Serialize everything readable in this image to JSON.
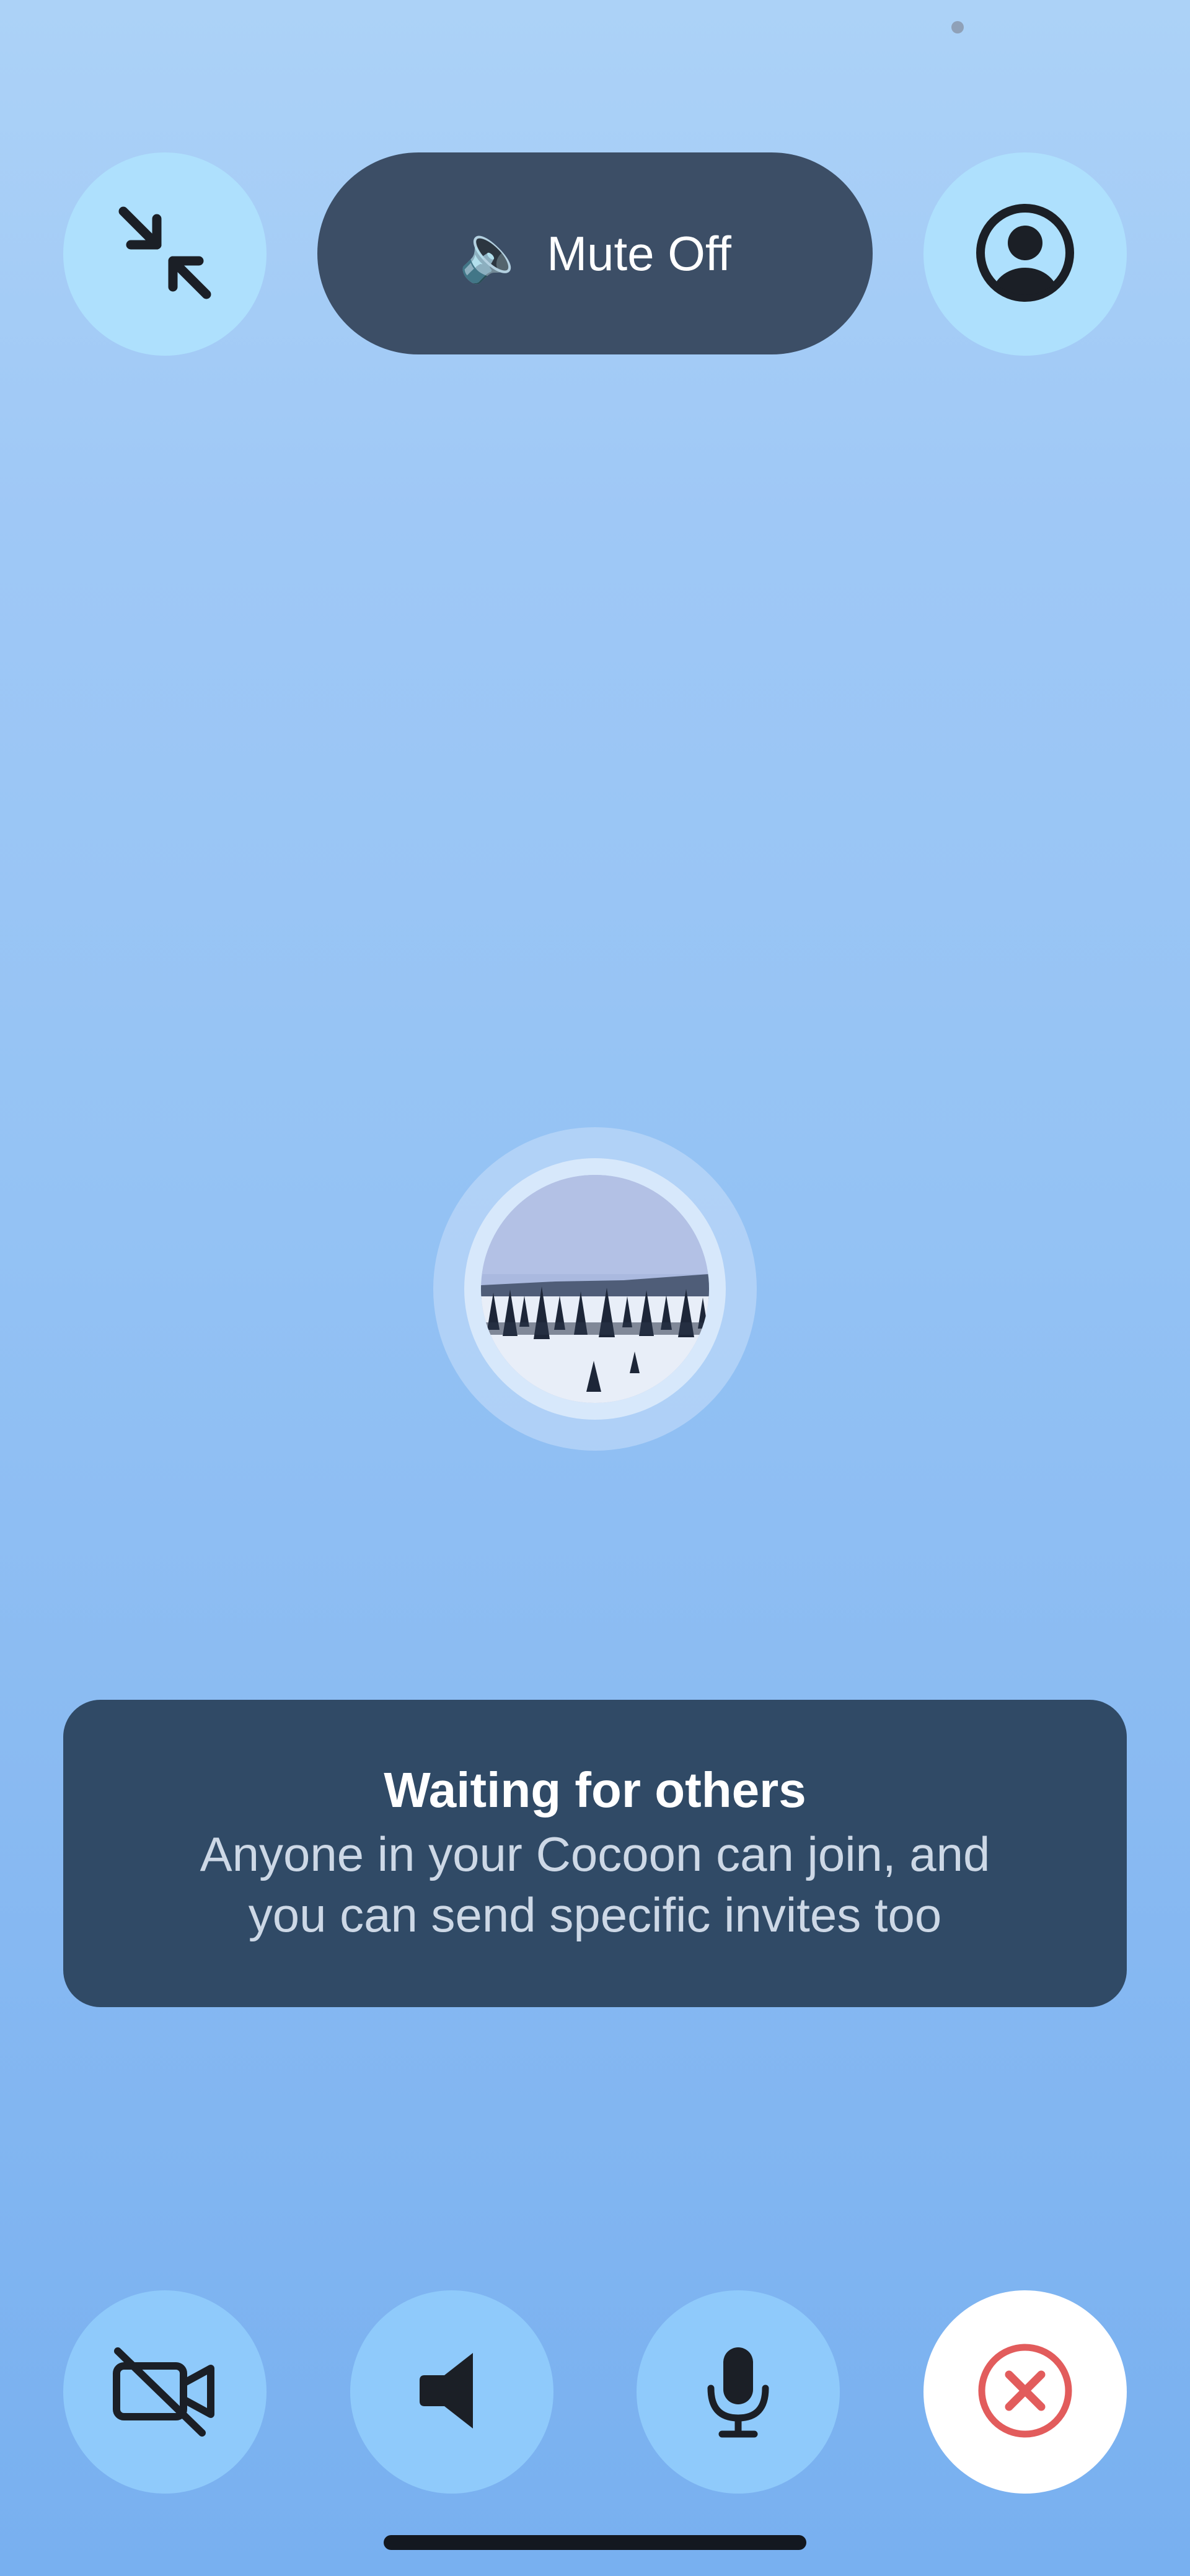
{
  "status_bar": {
    "indicator": "status-dot"
  },
  "top_bar": {
    "minimize_icon": "minimize-arrows-icon",
    "mute_button": {
      "icon": "speaker-icon",
      "glyph": "🔈",
      "label": "Mute Off"
    },
    "profile_icon": "profile-icon"
  },
  "participant": {
    "avatar": "landscape-photo"
  },
  "info_card": {
    "title": "Waiting for others",
    "message": "Anyone in your Cocoon can join, and you can send specific invites too"
  },
  "controls": {
    "camera": {
      "icon": "video-off-icon"
    },
    "speaker": {
      "icon": "speaker-icon"
    },
    "microphone": {
      "icon": "microphone-icon"
    },
    "end_call": {
      "icon": "close-circle-icon",
      "color": "#e25c5c"
    }
  },
  "colors": {
    "accent_dark": "#304a66",
    "pill": "#3c4e66",
    "button_light": "#aee0fd",
    "button_bottom": "#8fcafb",
    "danger": "#e25c5c"
  }
}
